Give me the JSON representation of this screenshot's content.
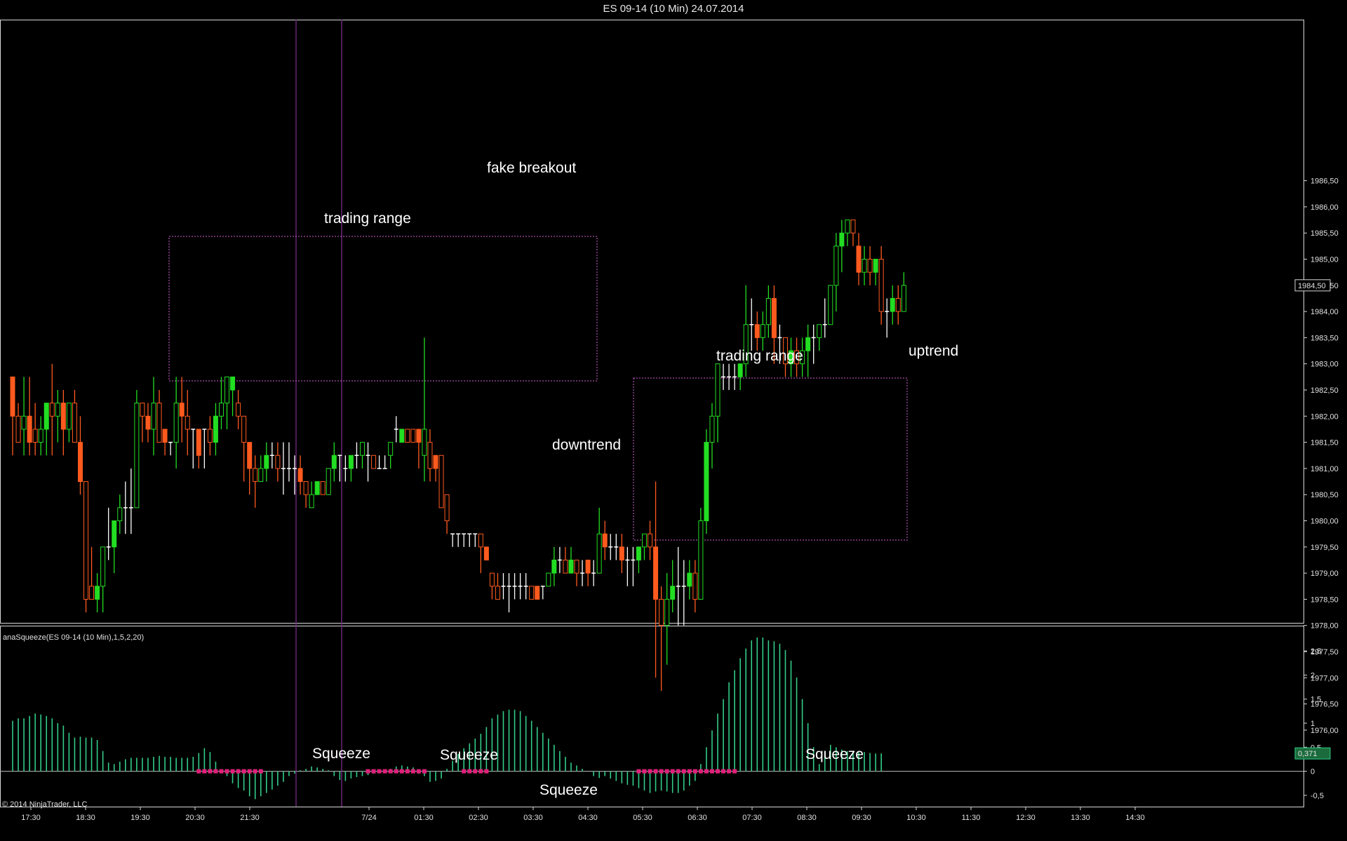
{
  "window": {
    "title": "ES 09-14 (10 Min)  24.07.2014"
  },
  "indicator_label": "anaSqueeze(ES 09-14 (10 Min),1,5,2,20)",
  "copyright": "© 2014 NinjaTrader, LLC",
  "price_marker": "1984,50",
  "indicator_marker": "0,371",
  "colors": {
    "background": "#000000",
    "up_bar": "#22dd22",
    "down_bar": "#ff5a1e",
    "doji_bar": "#ffffff",
    "histogram": "#33cc88",
    "squeeze_dot": "#e0207a",
    "box_border": "#d060d0",
    "session_line": "#7a2a8a"
  },
  "annotations": [
    {
      "text": "trading range",
      "time": "21:20 prev",
      "price": 1983.2
    },
    {
      "text": "fake breakout",
      "time": "03:30",
      "price": 1984.2
    },
    {
      "text": "downtrend",
      "time": "04:50",
      "price": 1979.0
    },
    {
      "text": "trading range",
      "time": "07:50",
      "price": 1980.6
    },
    {
      "text": "uptrend",
      "time": "10:10",
      "price": 1980.7
    },
    {
      "text": "Squeeze",
      "time": "22:40 prev",
      "indicator": 0.35
    },
    {
      "text": "Squeeze",
      "time": "02:10",
      "indicator": 0.3
    },
    {
      "text": "Squeeze",
      "time": "03:50",
      "indicator": -0.38
    },
    {
      "text": "Squeeze",
      "time": "08:30",
      "indicator": 0.32
    }
  ],
  "chart_data": [
    {
      "type": "candlestick",
      "title": "ES 09-14 (10 Min)  24.07.2014",
      "x_tick_labels": [
        "17:30",
        "18:30",
        "19:30",
        "20:30",
        "21:30",
        "7/24",
        "01:30",
        "02:30",
        "03:30",
        "04:30",
        "05:30",
        "06:30",
        "07:30",
        "08:30",
        "09:30",
        "10:30",
        "11:30",
        "12:30",
        "13:30",
        "14:30"
      ],
      "y_tick_labels": [
        "1976,00",
        "1976,50",
        "1977,00",
        "1977,50",
        "1978,00",
        "1978,50",
        "1979,00",
        "1979,50",
        "1980,00",
        "1980,50",
        "1981,00",
        "1981,50",
        "1982,00",
        "1982,50",
        "1983,00",
        "1983,50",
        "1984,00",
        "1984,50",
        "1985,00",
        "1985,50",
        "1986,00",
        "1986,50"
      ],
      "ylim": [
        1975.6,
        1987.0
      ],
      "grid": false,
      "bars": [
        [
          1982.75,
          1982.75,
          1981.25,
          1982.0
        ],
        [
          1982.0,
          1982.25,
          1981.75,
          1981.5
        ],
        [
          1981.75,
          1982.75,
          1981.25,
          1982.0
        ],
        [
          1982.0,
          1982.75,
          1981.25,
          1981.5
        ],
        [
          1981.75,
          1982.25,
          1981.25,
          1981.5
        ],
        [
          1981.5,
          1982.0,
          1981.25,
          1981.75
        ],
        [
          1981.75,
          1982.25,
          1981.25,
          1982.25
        ],
        [
          1982.25,
          1983.0,
          1981.25,
          1982.0
        ],
        [
          1982.0,
          1982.5,
          1981.5,
          1982.25
        ],
        [
          1982.25,
          1982.5,
          1981.25,
          1981.75
        ],
        [
          1981.75,
          1982.25,
          1981.5,
          1982.25
        ],
        [
          1982.25,
          1982.5,
          1981.5,
          1981.5
        ],
        [
          1981.5,
          1982.0,
          1980.5,
          1980.75
        ],
        [
          1980.75,
          1980.75,
          1978.25,
          1978.5
        ],
        [
          1978.75,
          1979.5,
          1978.75,
          1978.5
        ],
        [
          1978.5,
          1979.0,
          1978.25,
          1978.75
        ],
        [
          1978.75,
          1979.5,
          1978.25,
          1979.5
        ],
        [
          1979.5,
          1980.25,
          1979.25,
          1979.5
        ],
        [
          1979.5,
          1980.0,
          1979.0,
          1980.0
        ],
        [
          1980.0,
          1980.5,
          1979.75,
          1980.25
        ],
        [
          1980.25,
          1980.75,
          1979.75,
          1980.25
        ],
        [
          1980.25,
          1981.0,
          1979.75,
          1980.25
        ],
        [
          1980.25,
          1982.5,
          1980.25,
          1982.25
        ],
        [
          1982.25,
          1982.25,
          1981.5,
          1982.0
        ],
        [
          1982.0,
          1982.25,
          1981.5,
          1981.75
        ],
        [
          1981.75,
          1982.75,
          1981.25,
          1982.25
        ],
        [
          1982.25,
          1982.5,
          1981.5,
          1981.5
        ],
        [
          1981.75,
          1981.75,
          1981.25,
          1981.5
        ],
        [
          1981.5,
          1981.5,
          1981.25,
          1981.5
        ],
        [
          1981.5,
          1982.75,
          1981.0,
          1982.25
        ],
        [
          1982.25,
          1982.75,
          1981.5,
          1982.0
        ],
        [
          1982.0,
          1982.5,
          1981.25,
          1981.75
        ],
        [
          1981.75,
          1981.75,
          1981.0,
          1981.75
        ],
        [
          1981.75,
          1981.75,
          1981.0,
          1981.25
        ],
        [
          1981.75,
          1981.75,
          1981.0,
          1981.75
        ],
        [
          1981.75,
          1982.0,
          1981.25,
          1981.5
        ],
        [
          1981.5,
          1982.25,
          1981.25,
          1982.0
        ],
        [
          1982.0,
          1982.75,
          1981.75,
          1982.25
        ],
        [
          1982.25,
          1982.75,
          1981.75,
          1982.75
        ],
        [
          1982.5,
          1982.75,
          1982.0,
          1982.75
        ],
        [
          1982.25,
          1982.5,
          1981.75,
          1982.0
        ],
        [
          1982.0,
          1982.0,
          1980.75,
          1981.5
        ],
        [
          1981.5,
          1981.5,
          1980.5,
          1981.0
        ],
        [
          1981.0,
          1981.25,
          1980.25,
          1980.75
        ],
        [
          1980.75,
          1981.25,
          1980.75,
          1981.0
        ],
        [
          1981.0,
          1981.5,
          1980.75,
          1981.25
        ],
        [
          1981.25,
          1981.5,
          1981.0,
          1981.25
        ],
        [
          1981.25,
          1981.5,
          1980.75,
          1981.0
        ],
        [
          1981.0,
          1981.5,
          1980.5,
          1981.0
        ],
        [
          1981.0,
          1981.5,
          1980.75,
          1981.0
        ],
        [
          1981.0,
          1981.25,
          1980.5,
          1981.0
        ],
        [
          1981.0,
          1981.25,
          1980.5,
          1980.75
        ],
        [
          1980.75,
          1980.75,
          1980.25,
          1980.5
        ],
        [
          1980.25,
          1980.75,
          1980.25,
          1980.5
        ],
        [
          1980.5,
          1980.75,
          1980.5,
          1980.75
        ],
        [
          1980.75,
          1980.75,
          1980.5,
          1980.5
        ],
        [
          1980.5,
          1981.0,
          1980.5,
          1981.0
        ],
        [
          1981.0,
          1981.5,
          1980.75,
          1981.25
        ],
        [
          1981.25,
          1981.25,
          1980.75,
          1981.25
        ],
        [
          1981.0,
          1981.25,
          1980.75,
          1981.0
        ],
        [
          1981.0,
          1981.25,
          1980.75,
          1981.25
        ],
        [
          1981.25,
          1981.5,
          1981.0,
          1981.25
        ],
        [
          1981.25,
          1981.5,
          1981.0,
          1981.5
        ],
        [
          1981.25,
          1981.5,
          1980.75,
          1981.25
        ],
        [
          1981.25,
          1981.25,
          1981.0,
          1981.0
        ],
        [
          1981.0,
          1981.25,
          1981.0,
          1981.0
        ],
        [
          1981.0,
          1981.25,
          1981.0,
          1981.0
        ],
        [
          1981.25,
          1981.5,
          1981.0,
          1981.5
        ],
        [
          1981.75,
          1982.0,
          1981.5,
          1981.75
        ],
        [
          1981.5,
          1981.75,
          1981.5,
          1981.75
        ],
        [
          1981.75,
          1981.75,
          1981.5,
          1981.5
        ],
        [
          1981.75,
          1981.75,
          1981.5,
          1981.5
        ],
        [
          1981.75,
          1981.75,
          1981.0,
          1981.5
        ],
        [
          1981.25,
          1983.5,
          1980.75,
          1981.75
        ],
        [
          1981.5,
          1981.75,
          1980.75,
          1981.0
        ],
        [
          1981.25,
          1981.25,
          1980.75,
          1981.0
        ],
        [
          1981.25,
          1981.25,
          1980.25,
          1980.25
        ],
        [
          1980.5,
          1980.5,
          1979.75,
          1980.0
        ],
        [
          1979.75,
          1979.75,
          1979.5,
          1979.75
        ],
        [
          1979.75,
          1979.75,
          1979.5,
          1979.75
        ],
        [
          1979.75,
          1979.75,
          1979.5,
          1979.75
        ],
        [
          1979.75,
          1979.75,
          1979.5,
          1979.75
        ],
        [
          1979.75,
          1979.75,
          1979.5,
          1979.75
        ],
        [
          1979.75,
          1979.75,
          1979.0,
          1979.5
        ],
        [
          1979.5,
          1979.5,
          1979.25,
          1979.25
        ],
        [
          1979.0,
          1979.0,
          1978.5,
          1978.75
        ],
        [
          1978.75,
          1979.0,
          1978.5,
          1978.5
        ],
        [
          1978.75,
          1979.0,
          1978.5,
          1978.75
        ],
        [
          1978.75,
          1979.0,
          1978.25,
          1978.75
        ],
        [
          1978.75,
          1979.0,
          1978.5,
          1978.75
        ],
        [
          1978.75,
          1979.0,
          1978.5,
          1978.75
        ],
        [
          1978.75,
          1979.0,
          1978.5,
          1978.75
        ],
        [
          1978.75,
          1978.75,
          1978.5,
          1978.5
        ],
        [
          1978.75,
          1978.75,
          1978.5,
          1978.5
        ],
        [
          1978.75,
          1978.75,
          1978.5,
          1978.75
        ],
        [
          1978.75,
          1979.0,
          1978.75,
          1979.0
        ],
        [
          1979.0,
          1979.5,
          1978.75,
          1979.25
        ],
        [
          1979.25,
          1979.5,
          1979.0,
          1979.25
        ],
        [
          1979.25,
          1979.5,
          1979.0,
          1979.0
        ],
        [
          1979.0,
          1979.5,
          1979.0,
          1979.25
        ],
        [
          1979.25,
          1979.25,
          1978.75,
          1979.0
        ],
        [
          1979.0,
          1979.25,
          1978.75,
          1979.0
        ],
        [
          1979.25,
          1979.25,
          1978.75,
          1979.0
        ],
        [
          1979.0,
          1979.25,
          1978.75,
          1979.0
        ],
        [
          1979.0,
          1980.25,
          1979.0,
          1979.75
        ],
        [
          1979.75,
          1980.0,
          1979.25,
          1979.5
        ],
        [
          1979.5,
          1979.75,
          1979.25,
          1979.5
        ],
        [
          1979.5,
          1979.75,
          1979.25,
          1979.5
        ],
        [
          1979.5,
          1979.75,
          1979.0,
          1979.25
        ],
        [
          1979.25,
          1979.5,
          1978.75,
          1979.25
        ],
        [
          1979.25,
          1979.5,
          1978.75,
          1979.25
        ],
        [
          1979.25,
          1979.5,
          1979.0,
          1979.5
        ],
        [
          1979.5,
          1979.75,
          1979.25,
          1979.75
        ],
        [
          1979.75,
          1980.0,
          1979.25,
          1979.5
        ],
        [
          1979.5,
          1980.75,
          1977.0,
          1978.5
        ],
        [
          1978.5,
          1978.75,
          1976.75,
          1978.0
        ],
        [
          1978.0,
          1979.0,
          1977.25,
          1978.5
        ],
        [
          1978.5,
          1979.25,
          1978.25,
          1978.75
        ],
        [
          1978.75,
          1979.5,
          1978.0,
          1978.75
        ],
        [
          1978.75,
          1979.25,
          1978.0,
          1978.75
        ],
        [
          1978.75,
          1979.25,
          1978.5,
          1979.0
        ],
        [
          1979.0,
          1979.25,
          1978.25,
          1978.5
        ],
        [
          1978.5,
          1980.25,
          1978.5,
          1980.0
        ],
        [
          1980.0,
          1981.75,
          1979.75,
          1981.5
        ],
        [
          1981.5,
          1982.25,
          1981.0,
          1982.0
        ],
        [
          1982.0,
          1983.0,
          1981.5,
          1983.0
        ],
        [
          1982.75,
          1983.0,
          1982.5,
          1982.75
        ],
        [
          1982.75,
          1983.0,
          1982.5,
          1982.75
        ],
        [
          1982.75,
          1983.0,
          1982.5,
          1982.75
        ],
        [
          1982.75,
          1983.0,
          1982.5,
          1983.0
        ],
        [
          1983.0,
          1984.5,
          1982.75,
          1983.75
        ],
        [
          1983.75,
          1984.25,
          1983.25,
          1983.75
        ],
        [
          1983.75,
          1984.0,
          1983.25,
          1983.5
        ],
        [
          1983.5,
          1984.0,
          1983.25,
          1983.75
        ],
        [
          1983.75,
          1984.5,
          1983.5,
          1984.25
        ],
        [
          1984.25,
          1984.5,
          1983.0,
          1983.5
        ],
        [
          1983.5,
          1983.75,
          1983.0,
          1983.5
        ],
        [
          1983.5,
          1983.5,
          1982.75,
          1983.0
        ],
        [
          1983.0,
          1983.5,
          1982.75,
          1983.25
        ],
        [
          1983.25,
          1983.5,
          1982.75,
          1983.0
        ],
        [
          1983.0,
          1983.5,
          1982.75,
          1983.25
        ],
        [
          1983.25,
          1983.75,
          1982.75,
          1983.5
        ],
        [
          1983.5,
          1983.75,
          1983.0,
          1983.5
        ],
        [
          1983.5,
          1983.75,
          1983.25,
          1983.75
        ],
        [
          1983.75,
          1984.25,
          1983.5,
          1983.75
        ],
        [
          1983.75,
          1984.5,
          1983.75,
          1984.5
        ],
        [
          1984.5,
          1985.5,
          1984.0,
          1985.25
        ],
        [
          1985.25,
          1985.75,
          1984.75,
          1985.5
        ],
        [
          1985.5,
          1985.75,
          1985.25,
          1985.75
        ],
        [
          1985.75,
          1985.75,
          1985.25,
          1985.5
        ],
        [
          1985.25,
          1985.5,
          1984.5,
          1984.75
        ],
        [
          1984.75,
          1985.25,
          1984.5,
          1985.0
        ],
        [
          1985.0,
          1985.25,
          1984.5,
          1984.75
        ],
        [
          1984.75,
          1985.0,
          1984.5,
          1985.0
        ],
        [
          1985.0,
          1985.25,
          1983.75,
          1984.0
        ],
        [
          1984.0,
          1984.25,
          1983.5,
          1984.0
        ],
        [
          1984.0,
          1984.5,
          1983.75,
          1984.25
        ],
        [
          1984.25,
          1984.5,
          1983.75,
          1984.0
        ],
        [
          1984.0,
          1984.75,
          1984.0,
          1984.5
        ]
      ]
    },
    {
      "type": "bar",
      "title": "anaSqueeze(ES 09-14 (10 Min),1,5,2,20)",
      "y_tick_labels": [
        "-0,5",
        "0",
        "0,5",
        "1",
        "1,5",
        "2",
        "2,5"
      ],
      "ylim": [
        -0.75,
        2.85
      ],
      "values": [
        1.05,
        1.1,
        1.1,
        1.15,
        1.2,
        1.18,
        1.15,
        1.1,
        1.0,
        0.95,
        0.8,
        0.7,
        0.72,
        0.7,
        0.7,
        0.65,
        0.42,
        0.18,
        0.15,
        0.2,
        0.25,
        0.28,
        0.28,
        0.28,
        0.28,
        0.3,
        0.32,
        0.3,
        0.3,
        0.28,
        0.28,
        0.28,
        0.3,
        0.38,
        0.48,
        0.4,
        0.2,
        0.0,
        -0.1,
        -0.25,
        -0.35,
        -0.4,
        -0.52,
        -0.58,
        -0.52,
        -0.45,
        -0.38,
        -0.3,
        -0.22,
        -0.1,
        -0.05,
        0.02,
        0.05,
        0.1,
        0.08,
        0.05,
        0.02,
        -0.1,
        -0.18,
        -0.2,
        -0.15,
        -0.12,
        -0.1,
        -0.08,
        -0.05,
        -0.02,
        0.03,
        0.05,
        0.1,
        0.12,
        0.1,
        0.08,
        -0.05,
        -0.1,
        -0.22,
        -0.2,
        -0.15,
        0.05,
        0.22,
        0.36,
        0.48,
        0.58,
        0.68,
        0.78,
        0.92,
        1.1,
        1.18,
        1.25,
        1.28,
        1.28,
        1.25,
        1.15,
        1.05,
        0.92,
        0.8,
        0.68,
        0.55,
        0.42,
        0.3,
        0.18,
        0.12,
        0.05,
        0.0,
        -0.1,
        -0.14,
        -0.1,
        -0.15,
        -0.2,
        -0.25,
        -0.28,
        -0.3,
        -0.35,
        -0.4,
        -0.45,
        -0.42,
        -0.4,
        -0.42,
        -0.45,
        -0.45,
        -0.4,
        -0.3,
        -0.2,
        0.15,
        0.5,
        0.85,
        1.2,
        1.5,
        1.85,
        2.1,
        2.35,
        2.55,
        2.72,
        2.78,
        2.78,
        2.72,
        2.7,
        2.65,
        2.52,
        2.3,
        1.95,
        1.5,
        1.0,
        0.5,
        0.15,
        0.38,
        0.55,
        0.5,
        0.45,
        0.42,
        0.42,
        0.4,
        0.4,
        0.38,
        0.37,
        0.37
      ],
      "squeeze_ranges": [
        [
          31,
          40
        ],
        [
          45,
          60
        ],
        [
          58,
          62
        ],
        [
          85,
          104
        ]
      ]
    }
  ]
}
